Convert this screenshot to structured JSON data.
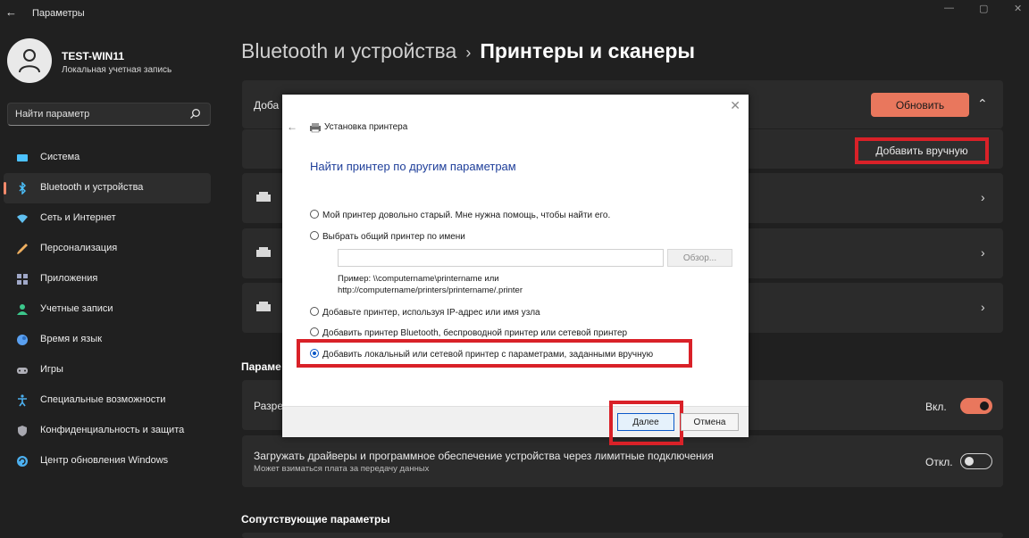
{
  "window": {
    "back_glyph": "←",
    "title": "Параметры",
    "minimize_glyph": "—",
    "maximize_glyph": "▢",
    "close_glyph": "✕"
  },
  "profile": {
    "name": "TEST-WIN11",
    "account_type": "Локальная учетная запись"
  },
  "search": {
    "placeholder": "Найти параметр",
    "icon": "search-icon"
  },
  "sidebar": {
    "items": [
      {
        "label": "Система",
        "icon": "system-icon",
        "color": "#4cc2ff"
      },
      {
        "label": "Bluetooth и устройства",
        "icon": "bluetooth-icon",
        "color": "#4cc2ff",
        "active": true
      },
      {
        "label": "Сеть и Интернет",
        "icon": "wifi-icon",
        "color": "#60c0f0"
      },
      {
        "label": "Персонализация",
        "icon": "brush-icon",
        "color": "#f0b060"
      },
      {
        "label": "Приложения",
        "icon": "apps-icon",
        "color": "#a0a8c8"
      },
      {
        "label": "Учетные записи",
        "icon": "person-icon",
        "color": "#3cc88c"
      },
      {
        "label": "Время и язык",
        "icon": "globe-icon",
        "color": "#5aa0f0"
      },
      {
        "label": "Игры",
        "icon": "gamepad-icon",
        "color": "#b0b0b8"
      },
      {
        "label": "Специальные возможности",
        "icon": "accessibility-icon",
        "color": "#4cb0f0"
      },
      {
        "label": "Конфиденциальность и защита",
        "icon": "shield-icon",
        "color": "#a8a8b0"
      },
      {
        "label": "Центр обновления Windows",
        "icon": "update-icon",
        "color": "#4cb0f0"
      }
    ]
  },
  "breadcrumb": {
    "parent": "Bluetooth и устройства",
    "separator": "›",
    "current": "Принтеры и сканеры"
  },
  "main": {
    "add_card_label_partial": "Доба",
    "refresh_button": "Обновить",
    "add_manual_button": "Добавить вручную",
    "section_params_partial": "Параме",
    "setting1_partial": "Разре",
    "setting1_state": "Вкл.",
    "setting2_title": "Загружать драйверы и программное обеспечение устройства через лимитные подключения",
    "setting2_subtitle": "Может взиматься плата за передачу данных",
    "setting2_state": "Откл.",
    "related_title": "Сопутствующие параметры",
    "chevron_up": "⌃",
    "chevron_right": "›"
  },
  "dialog": {
    "title": "Установка принтера",
    "heading": "Найти принтер по другим параметрам",
    "close_glyph": "✕",
    "back_glyph": "←",
    "options": [
      {
        "label": "Мой принтер довольно старый. Мне нужна помощь, чтобы найти его.",
        "selected": false
      },
      {
        "label": "Выбрать общий принтер по имени",
        "selected": false
      },
      {
        "label": "Добавьте принтер, используя IP-адрес или имя узла",
        "selected": false
      },
      {
        "label": "Добавить принтер Bluetooth, беспроводной принтер или сетевой принтер",
        "selected": false
      },
      {
        "label": "Добавить локальный или сетевой принтер с параметрами, заданными вручную",
        "selected": true
      }
    ],
    "name_input_value": "",
    "browse_button": "Обзор...",
    "example_line1": "Пример: \\\\computername\\printername или",
    "example_line2": "http://computername/printers/printername/.printer",
    "next_button": "Далее",
    "cancel_button": "Отмена"
  },
  "colors": {
    "accent": "#e9775d",
    "highlight": "#d92128",
    "background": "#202020",
    "card": "#2b2b2b"
  }
}
